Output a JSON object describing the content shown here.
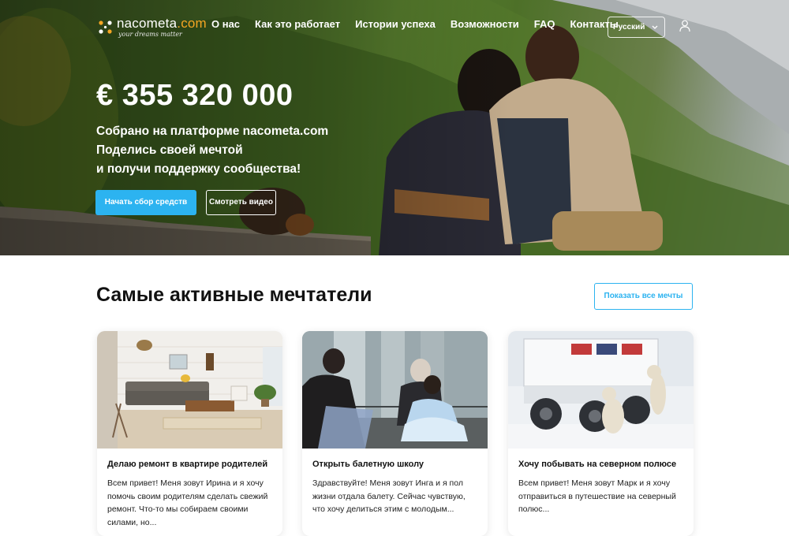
{
  "brand": {
    "name_main": "nacometa",
    "name_accent": ".com",
    "tagline": "your dreams matter"
  },
  "nav": {
    "links": [
      "О нас",
      "Как это работает",
      "Истории успеха",
      "Возможности",
      "FAQ",
      "Контакты"
    ],
    "language": "Русский",
    "icons": {
      "language_chevron": "chevron-down-icon",
      "account": "user-icon"
    }
  },
  "hero": {
    "amount": "€ 355 320 000",
    "lines": [
      "Собрано на платформе nacometa.com",
      "Поделись своей мечтой",
      "и получи поддержку сообщества!"
    ],
    "primary_button": "Начать сбор средств",
    "secondary_button": "Смотреть видео"
  },
  "section": {
    "title": "Самые активные мечтатели",
    "show_all_button": "Показать все мечты"
  },
  "cards": [
    {
      "title": "Делаю ремонт в квартире родителей",
      "text": "Всем привет! Меня зовут Ирина и я хочу помочь своим родителям сделать свежий ремонт. Что-то мы собираем своими силами, но..."
    },
    {
      "title": "Открыть балетную школу",
      "text": "Здравствуйте! Меня зовут Инга и я пол жизни отдала балету. Сейчас чувствую, что хочу делиться этим с молодым..."
    },
    {
      "title": "Хочу побывать на северном полюсе",
      "text": "Всем привет! Меня зовут Марк и я хочу отправиться в путешествие на северный полюс..."
    }
  ],
  "colors": {
    "accent": "#2cb3f0",
    "brand_accent": "#f5a623",
    "heading": "#111111"
  }
}
